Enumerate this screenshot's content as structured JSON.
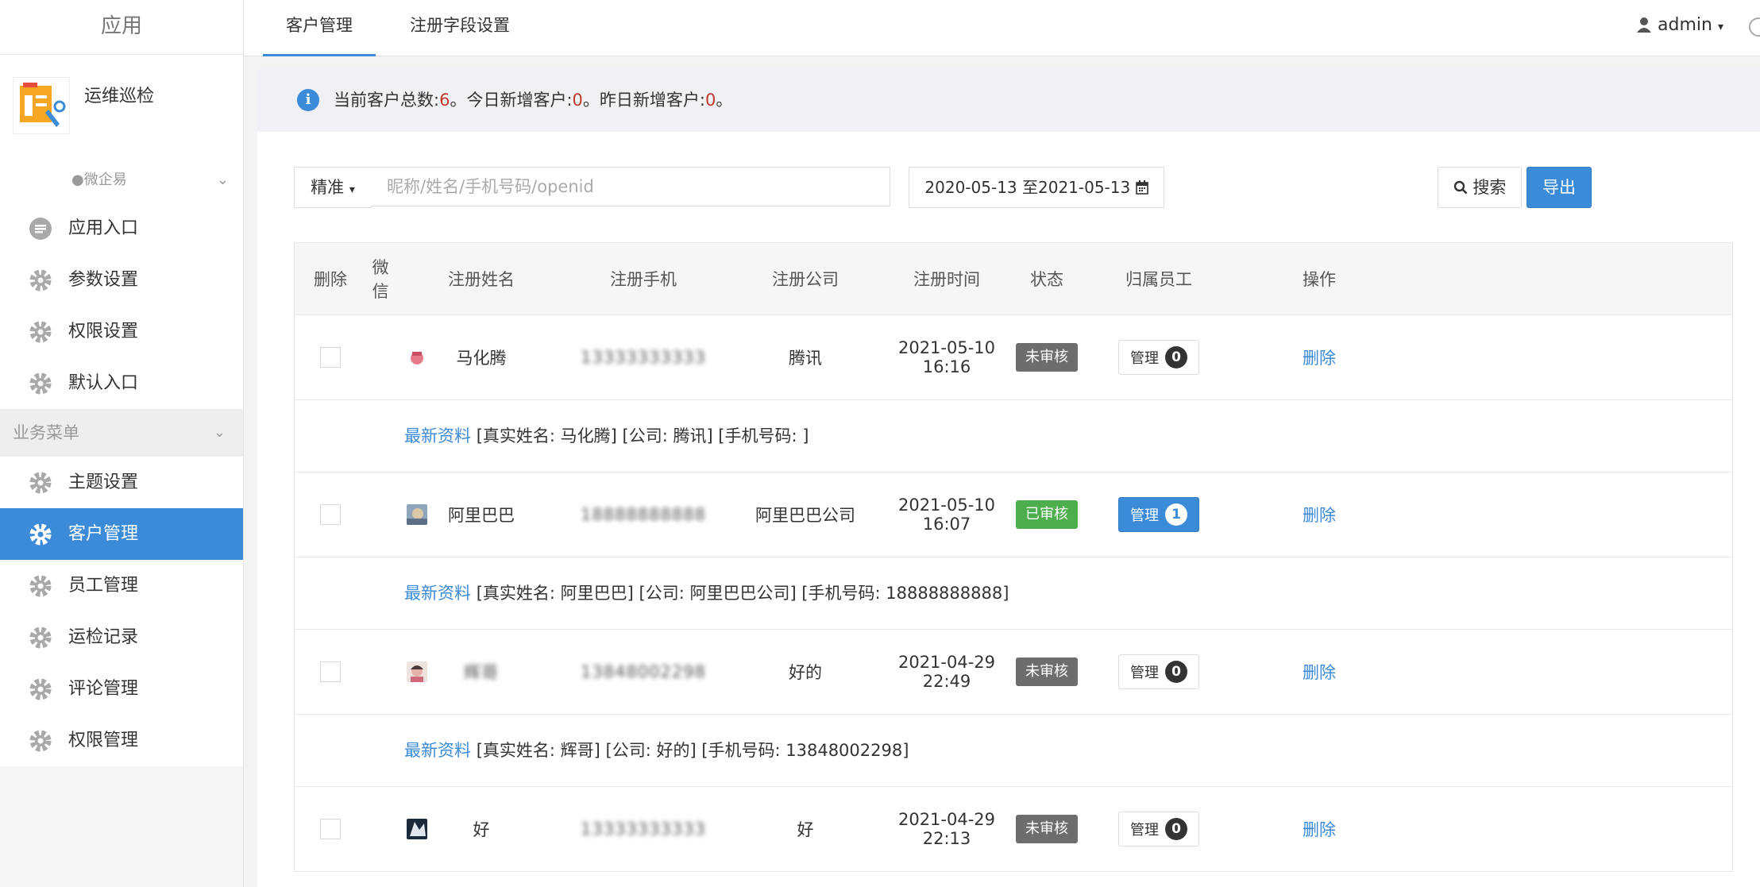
{
  "sidebar": {
    "header": "应用",
    "app": {
      "name": "运维巡检"
    },
    "wx_group": "微企易",
    "items_top": [
      {
        "label": "应用入口",
        "icon": "chat-icon"
      },
      {
        "label": "参数设置",
        "icon": "gear-icon"
      },
      {
        "label": "权限设置",
        "icon": "gear-icon"
      },
      {
        "label": "默认入口",
        "icon": "gear-icon"
      }
    ],
    "business_group": "业务菜单",
    "items_business": [
      {
        "label": "主题设置",
        "icon": "gear-icon"
      },
      {
        "label": "客户管理",
        "icon": "gear-icon",
        "active": true
      },
      {
        "label": "员工管理",
        "icon": "gear-icon"
      },
      {
        "label": "运检记录",
        "icon": "gear-icon"
      },
      {
        "label": "评论管理",
        "icon": "gear-icon"
      },
      {
        "label": "权限管理",
        "icon": "gear-icon"
      }
    ]
  },
  "topbar": {
    "tabs": [
      {
        "label": "客户管理",
        "active": true
      },
      {
        "label": "注册字段设置",
        "active": false
      }
    ],
    "user": "admin"
  },
  "notice": {
    "t1": "当前客户总数:",
    "total": "6",
    "t2": "。今日新增客户:",
    "today": "0",
    "t3": "。昨日新增客户:",
    "yesterday": "0",
    "t4": "。"
  },
  "filter": {
    "mode": "精准",
    "placeholder": "昵称/姓名/手机号码/openid",
    "date_range": "2020-05-13 至2021-05-13",
    "search_label": "搜索",
    "export_label": "导出"
  },
  "table": {
    "headers": {
      "delete": "删除",
      "wechat": "微信",
      "name": "注册姓名",
      "phone": "注册手机",
      "company": "注册公司",
      "time": "注册时间",
      "status": "状态",
      "staff": "归属员工",
      "op": "操作"
    },
    "detail_link": "最新资料",
    "manage_label": "管理",
    "delete_label": "删除",
    "rows": [
      {
        "name": "马化腾",
        "phone": "13333333333",
        "company": "腾讯",
        "time": "2021-05-10 16:16",
        "status": "未审核",
        "count": "0",
        "detail": "[真实姓名: 马化腾] [公司: 腾讯] [手机号码: ]"
      },
      {
        "name": "阿里巴巴",
        "phone": "18888888888",
        "company": "阿里巴巴公司",
        "time": "2021-05-10 16:07",
        "status": "已审核",
        "count": "1",
        "detail": "[真实姓名: 阿里巴巴] [公司: 阿里巴巴公司] [手机号码: 18888888888]"
      },
      {
        "name": "辉哥",
        "phone": "13848002298",
        "company": "好的",
        "time": "2021-04-29 22:49",
        "status": "未审核",
        "count": "0",
        "detail": "[真实姓名: 辉哥] [公司: 好的] [手机号码: 13848002298]"
      },
      {
        "name": "好",
        "phone": "13333333333",
        "company": "好",
        "time": "2021-04-29 22:13",
        "status": "未审核",
        "count": "0"
      }
    ]
  },
  "colors": {
    "accent": "#3c8bd9",
    "pending": "#6d6d6d",
    "approved": "#4cae4c",
    "number": "#c0392b"
  }
}
